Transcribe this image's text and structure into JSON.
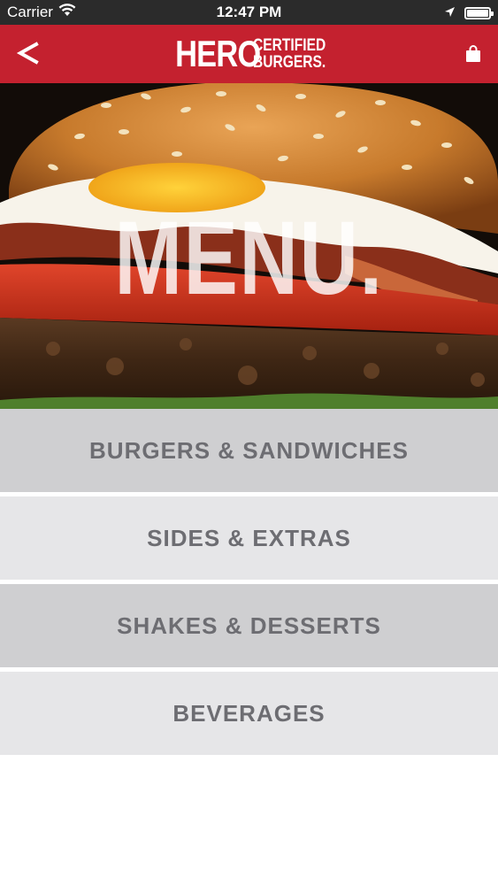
{
  "status_bar": {
    "carrier": "Carrier",
    "time": "12:47 PM",
    "wifi_icon": "wifi-icon",
    "location_icon": "location-arrow-icon",
    "battery_icon": "battery-full-icon"
  },
  "nav_bar": {
    "back_label": "<",
    "logo_main": "HERO",
    "logo_line1": "CERTIFIED",
    "logo_line2": "BURGERS.",
    "bag_icon": "shopping-bag-icon",
    "background_color": "#c4212f"
  },
  "hero": {
    "title": "MENU."
  },
  "menu": {
    "items": [
      {
        "label": "BURGERS & SANDWICHES"
      },
      {
        "label": "SIDES & EXTRAS"
      },
      {
        "label": "SHAKES & DESSERTS"
      },
      {
        "label": "BEVERAGES"
      }
    ]
  }
}
